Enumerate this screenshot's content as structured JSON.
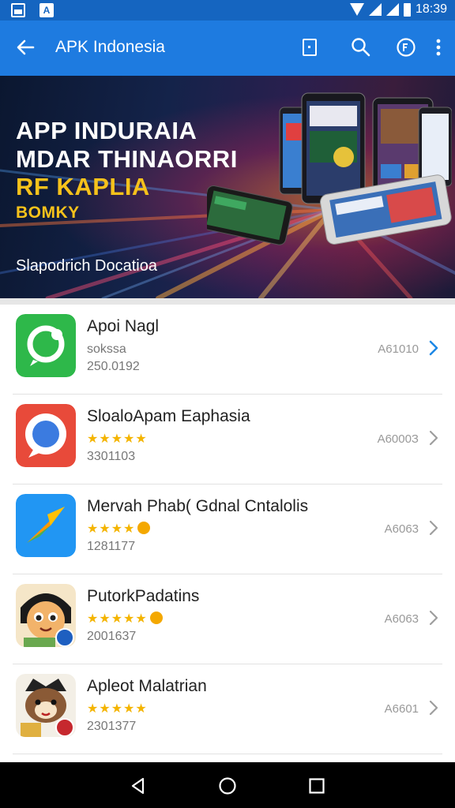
{
  "status_bar": {
    "time": "18:39"
  },
  "app_bar": {
    "title": "APK Indonesia"
  },
  "banner": {
    "line1": "APP INDURAIA",
    "line2": "MDAR THINAORRI",
    "line3": "RF KAPLIA",
    "line4": "BOMKY",
    "subtitle": "Slapodrich Docatioa"
  },
  "apps": [
    {
      "name": "Apoi Nagl",
      "line2": "sokssa",
      "line3": "250.0192",
      "size": "A61010",
      "rating": null,
      "chevron_color": "#1e88e5"
    },
    {
      "name": "SloaloApam Eaphasia",
      "line2": "",
      "line3": "3301103",
      "size": "A6000З",
      "rating": "★★★★★",
      "coin": false,
      "chevron_color": "#9e9e9e"
    },
    {
      "name": "Mervah Phab( Gdnal Cntalolis",
      "line2": "",
      "line3": "1281177",
      "size": "A6063",
      "rating": "★★★★",
      "coin": true,
      "chevron_color": "#9e9e9e"
    },
    {
      "name": "PutorkPadatins",
      "line2": "",
      "line3": "2001637",
      "size": "A6063",
      "rating": "★★★★★",
      "coin": true,
      "chevron_color": "#9e9e9e"
    },
    {
      "name": "Apleot Malatrian",
      "line2": "",
      "line3": "2301377",
      "size": "A6601",
      "rating": "★★★★★",
      "coin": false,
      "chevron_color": "#9e9e9e"
    }
  ],
  "icons": {
    "status_left": [
      "image-notification-icon",
      "app-notification-icon"
    ],
    "status_right": [
      "wifi-icon",
      "signal-icon",
      "battery-icon"
    ],
    "app_bar": [
      "back-arrow-icon",
      "bookmark-icon",
      "search-icon",
      "refresh-icon",
      "more-vert-icon"
    ],
    "nav": [
      "back-triangle-icon",
      "home-circle-icon",
      "recents-square-icon"
    ]
  },
  "colors": {
    "primary": "#1e7be0",
    "status": "#1565c0",
    "star": "#f4b400"
  }
}
